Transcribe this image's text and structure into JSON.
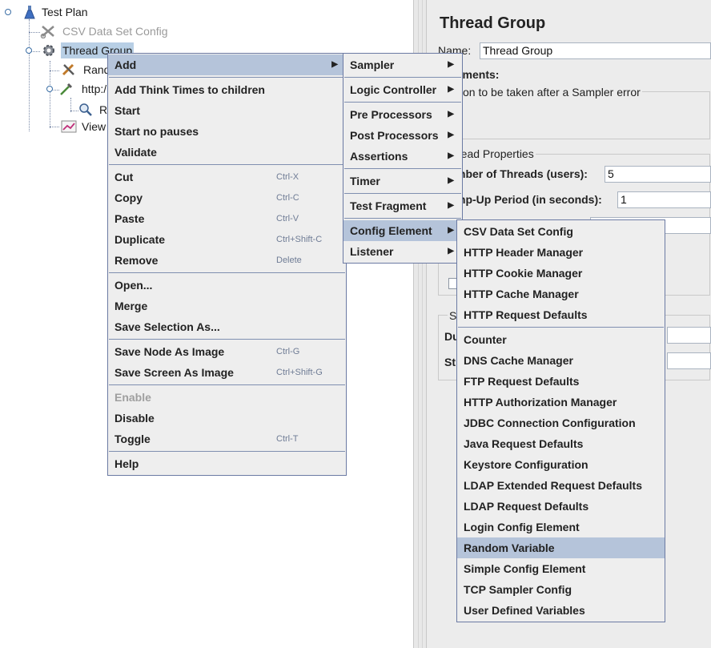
{
  "tree": {
    "nodes": [
      {
        "label": "Test Plan",
        "icon": "flask-icon"
      },
      {
        "label": "CSV Data Set Config",
        "icon": "scissors-icon"
      },
      {
        "label": "Thread Group",
        "icon": "gear-icon"
      },
      {
        "label": "Rand",
        "icon": "tools-icon"
      },
      {
        "label": "http:/",
        "icon": "pipette-icon"
      },
      {
        "label": "R",
        "icon": "magnifier-icon"
      },
      {
        "label": "View",
        "icon": "graph-icon"
      }
    ]
  },
  "panel": {
    "title": "Thread Group",
    "name_label": "Name:",
    "name_value": "Thread Group",
    "comments_label": "nments:",
    "action_label": "tion to be taken after a Sampler error",
    "thread_props_label": "read Properties",
    "threads_label": "mber of Threads (users):",
    "threads_value": "5",
    "rampup_label": "mp-Up Period (in seconds):",
    "rampup_value": "1",
    "s_label": "S",
    "du_label": "Du",
    "st_label": "St"
  },
  "context_menu": {
    "groups": [
      [
        {
          "label": "Add",
          "arrow": "▶",
          "highlighted": true
        }
      ],
      [
        {
          "label": "Add Think Times to children"
        },
        {
          "label": "Start"
        },
        {
          "label": "Start no pauses"
        },
        {
          "label": "Validate"
        }
      ],
      [
        {
          "label": "Cut",
          "shortcut": "Ctrl-X"
        },
        {
          "label": "Copy",
          "shortcut": "Ctrl-C"
        },
        {
          "label": "Paste",
          "shortcut": "Ctrl-V"
        },
        {
          "label": "Duplicate",
          "shortcut": "Ctrl+Shift-C"
        },
        {
          "label": "Remove",
          "shortcut": "Delete"
        }
      ],
      [
        {
          "label": "Open..."
        },
        {
          "label": "Merge"
        },
        {
          "label": "Save Selection As..."
        }
      ],
      [
        {
          "label": "Save Node As Image",
          "shortcut": "Ctrl-G"
        },
        {
          "label": "Save Screen As Image",
          "shortcut": "Ctrl+Shift-G"
        }
      ],
      [
        {
          "label": "Enable",
          "disabled": true
        },
        {
          "label": "Disable"
        },
        {
          "label": "Toggle",
          "shortcut": "Ctrl-T"
        }
      ],
      [
        {
          "label": "Help"
        }
      ]
    ]
  },
  "add_menu": {
    "groups": [
      [
        {
          "label": "Sampler",
          "arrow": "▶"
        }
      ],
      [
        {
          "label": "Logic Controller",
          "arrow": "▶"
        }
      ],
      [
        {
          "label": "Pre Processors",
          "arrow": "▶"
        },
        {
          "label": "Post Processors",
          "arrow": "▶"
        },
        {
          "label": "Assertions",
          "arrow": "▶"
        }
      ],
      [
        {
          "label": "Timer",
          "arrow": "▶"
        }
      ],
      [
        {
          "label": "Test Fragment",
          "arrow": "▶"
        }
      ],
      [
        {
          "label": "Config Element",
          "arrow": "▶",
          "highlighted": true
        },
        {
          "label": "Listener",
          "arrow": "▶"
        }
      ]
    ]
  },
  "config_menu": {
    "groups": [
      [
        {
          "label": "CSV Data Set Config"
        },
        {
          "label": "HTTP Header Manager"
        },
        {
          "label": "HTTP Cookie Manager"
        },
        {
          "label": "HTTP Cache Manager"
        },
        {
          "label": "HTTP Request Defaults"
        }
      ],
      [
        {
          "label": "Counter"
        },
        {
          "label": "DNS Cache Manager"
        },
        {
          "label": "FTP Request Defaults"
        },
        {
          "label": "HTTP Authorization Manager"
        },
        {
          "label": "JDBC Connection Configuration"
        },
        {
          "label": "Java Request Defaults"
        },
        {
          "label": "Keystore Configuration"
        },
        {
          "label": "LDAP Extended Request Defaults"
        },
        {
          "label": "LDAP Request Defaults"
        },
        {
          "label": "Login Config Element"
        },
        {
          "label": "Random Variable",
          "highlighted": true
        },
        {
          "label": "Simple Config Element"
        },
        {
          "label": "TCP Sampler Config"
        },
        {
          "label": "User Defined Variables"
        }
      ]
    ]
  },
  "colors": {
    "menu_bg": "#eeeeee",
    "menu_highlight": "#b5c4da",
    "menu_border": "#6b7aa3",
    "tree_selection": "#b8cfe5",
    "shortcut_text": "#6f7c95"
  }
}
